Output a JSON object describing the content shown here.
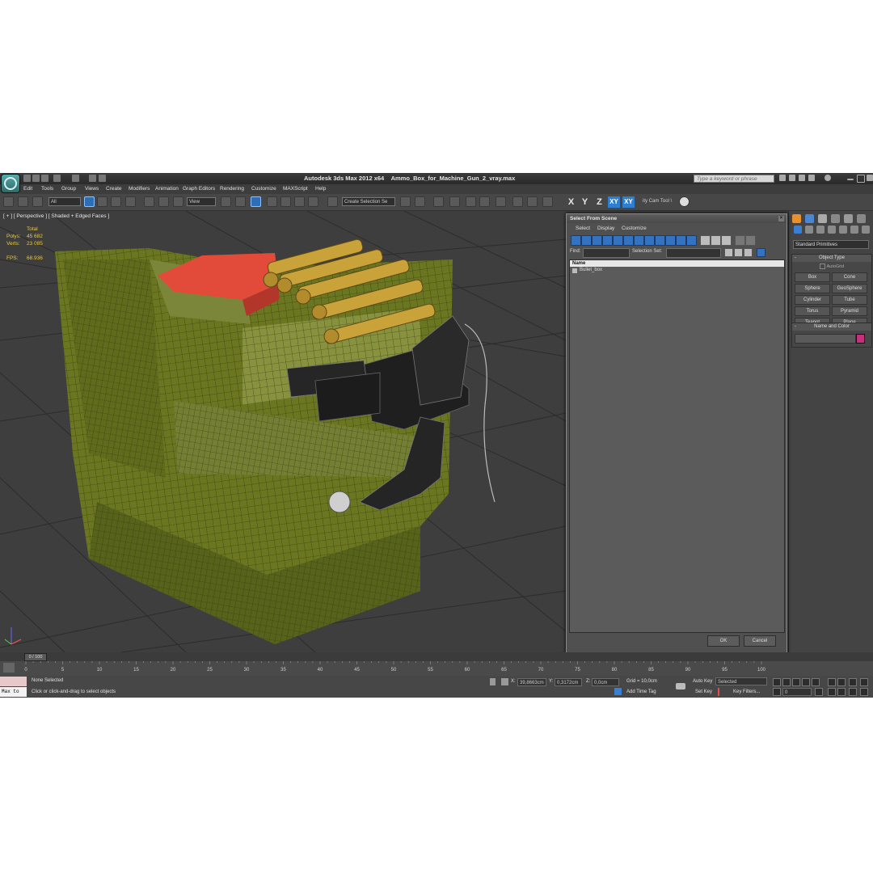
{
  "titlebar": {
    "app_title": "Autodesk 3ds Max  2012 x64",
    "file_name": "Ammo_Box_for_Machine_Gun_2_vray.max",
    "search_placeholder": "Type a keyword or phrase"
  },
  "menubar": [
    "Edit",
    "Tools",
    "Group",
    "Views",
    "Create",
    "Modifiers",
    "Animation",
    "Graph Editors",
    "Rendering",
    "Customize",
    "MAXScript",
    "Help"
  ],
  "toolbar": {
    "filter_dropdown": "All",
    "refcoord_dropdown": "View",
    "selection_set": "Create Selection Se",
    "axis_x": "X",
    "axis_y": "Y",
    "axis_z": "Z",
    "axis_xy": "XY",
    "axis_xy2": "XY",
    "tool_label": "ity Cam Tool \\"
  },
  "viewport": {
    "label": "[ + ] [ Perspective ] [ Shaded + Edged Faces ]",
    "stats_header": "Total",
    "polys_label": "Polys:",
    "polys_value": "45 682",
    "verts_label": "Verts:",
    "verts_value": "23 085",
    "fps_label": "FPS:",
    "fps_value": "68.936"
  },
  "dialog": {
    "title": "Select From Scene",
    "menus": [
      "Select",
      "Display",
      "Customize"
    ],
    "find_label": "Find:",
    "selection_set_label": "Selection Set:",
    "column_name": "Name",
    "items": [
      "Bullet_box"
    ],
    "ok_label": "OK",
    "cancel_label": "Cancel"
  },
  "command_panel": {
    "category_dropdown": "Standard Primitives",
    "object_type_title": "Object Type",
    "autogrid_label": "AutoGrid",
    "objects": [
      "Box",
      "Cone",
      "Sphere",
      "GeoSphere",
      "Cylinder",
      "Tube",
      "Torus",
      "Pyramid",
      "Teapot",
      "Plane"
    ],
    "name_color_title": "Name and Color",
    "object_color": "#c4307a"
  },
  "timeline": {
    "slider_label": "0 / 100",
    "ticks": [
      "0",
      "5",
      "10",
      "15",
      "20",
      "25",
      "30",
      "35",
      "40",
      "45",
      "50",
      "55",
      "60",
      "65",
      "70",
      "75",
      "80",
      "85",
      "90",
      "95",
      "100"
    ]
  },
  "status": {
    "maxscript_text": "Max to",
    "selection_status": "None Selected",
    "prompt": "Click or click-and-drag to select objects",
    "x_label": "X:",
    "x_value": "39,8663cm",
    "y_label": "Y:",
    "y_value": "0,3172cm",
    "z_label": "Z:",
    "z_value": "0,0cm",
    "grid": "Grid = 10,0cm",
    "add_time_tag": "Add Time Tag",
    "auto_key": "Auto Key",
    "set_key": "Set Key",
    "key_dropdown": "Selected",
    "key_filters": "Key Filters...",
    "frame_value": "0"
  }
}
